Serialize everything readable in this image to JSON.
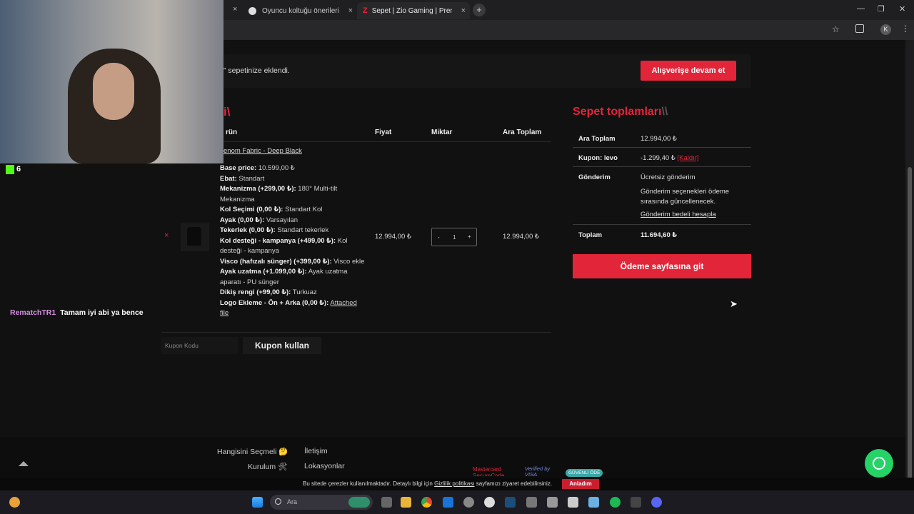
{
  "browser": {
    "tabs": [
      {
        "label": "Oyuncu koltuğu önerileri"
      },
      {
        "label": "Sepet | Zio Gaming | Premium O"
      }
    ],
    "new_tab": "+",
    "close_glyph": "×",
    "profile_initial": "K"
  },
  "notice": {
    "text": "” sepetinize eklendi.",
    "button": "Alışverişe devam et"
  },
  "cart": {
    "title_fragment": "i\\",
    "headers": {
      "product": "rün",
      "price": "Fiyat",
      "qty": "Miktar",
      "subtotal": "Ara Toplam"
    },
    "item": {
      "name": "enom Fabric - Deep Black",
      "options": [
        {
          "k": "Base price:",
          "v": " 10.599,00 ₺"
        },
        {
          "k": "Ebat:",
          "v": " Standart"
        },
        {
          "k": "Mekanizma (+299,00 ₺):",
          "v": " 180° Multi-tilt Mekanizma"
        },
        {
          "k": "Kol Seçimi (0,00 ₺):",
          "v": " Standart Kol"
        },
        {
          "k": "Ayak (0,00 ₺):",
          "v": " Varsayılan"
        },
        {
          "k": "Tekerlek (0,00 ₺):",
          "v": " Standart tekerlek"
        },
        {
          "k": "Kol desteği - kampanya (+499,00 ₺):",
          "v": " Kol desteği - kampanya"
        },
        {
          "k": "Visco (hafızalı sünger) (+399,00 ₺):",
          "v": " Visco ekle"
        },
        {
          "k": "Ayak uzatma (+1.099,00 ₺):",
          "v": " Ayak uzatma aparatı - PU sünger"
        },
        {
          "k": "Dikiş rengi (+99,00 ₺):",
          "v": " Turkuaz"
        },
        {
          "k": "Logo Ekleme - Ön + Arka (0,00 ₺):",
          "v": "Attached file"
        }
      ],
      "price": "12.994,00 ₺",
      "qty": "1",
      "minus": "-",
      "plus": "+",
      "subtotal": "12.994,00 ₺",
      "remove": "×"
    },
    "coupon": {
      "placeholder": "Kupon Kodu",
      "button": "Kupon kullan"
    }
  },
  "totals": {
    "title": "Sepet toplamları",
    "title_suffix": "\\\\",
    "subtotal_label": "Ara Toplam",
    "subtotal_value": "12.994,00 ₺",
    "coupon_label": "Kupon: levo",
    "coupon_value": "-1.299,40 ₺",
    "coupon_remove": "[Kaldır]",
    "shipping_label": "Gönderim",
    "shipping_value": "Ücretsiz gönderim",
    "shipping_note": "Gönderim seçenekleri ödeme sırasında güncellenecek.",
    "shipping_calc": "Gönderim bedeli hesapla",
    "total_label": "Toplam",
    "total_value": "11.694,60 ₺",
    "checkout": "Ödeme sayfasına git"
  },
  "footer": {
    "links_left": [
      "Hangisini Seçmeli 🤔",
      "Kurulum 🛠"
    ],
    "links_right": [
      "İletişim",
      "Lokasyonlar"
    ],
    "payment": [
      "Mastercard SecureCode",
      "Verified by VISA",
      "GÜVENLİ ÖDE"
    ]
  },
  "cookie": {
    "text_before": "Bu sitede çerezler kullanılmaktadır. Detaylı bilgi için ",
    "link": "Gizlilik politikası",
    "text_after": " sayfamızı ziyaret edebilirsiniz.",
    "button": "Anladım"
  },
  "overlay": {
    "viewer_count": "6",
    "chat_user": "RematchTR1",
    "chat_message": "Tamam iyi abi ya bence"
  },
  "taskbar": {
    "search_placeholder": "Ara"
  },
  "colors": {
    "accent": "#e3253a",
    "chat_user": "#d58ee0",
    "kick": "#53fc18"
  }
}
